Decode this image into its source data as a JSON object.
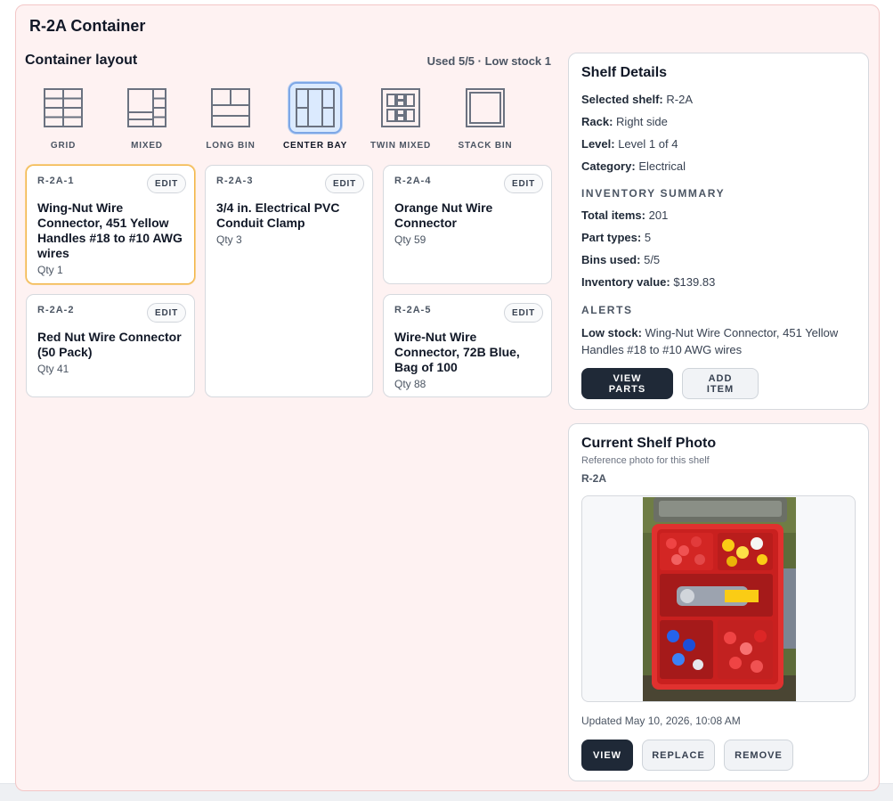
{
  "panel": {
    "title": "R-2A Container"
  },
  "layout": {
    "title": "Container layout",
    "stats": "Used 5/5 · Low stock 1",
    "options": [
      {
        "label": "GRID",
        "icon": "grid-layout-icon",
        "selected": false
      },
      {
        "label": "MIXED",
        "icon": "mixed-layout-icon",
        "selected": false
      },
      {
        "label": "LONG BIN",
        "icon": "long-bin-layout-icon",
        "selected": false
      },
      {
        "label": "CENTER BAY",
        "icon": "center-bay-layout-icon",
        "selected": true
      },
      {
        "label": "TWIN MIXED",
        "icon": "twin-mixed-layout-icon",
        "selected": false
      },
      {
        "label": "STACK BIN",
        "icon": "stack-bin-layout-icon",
        "selected": false
      }
    ]
  },
  "bins": [
    {
      "code": "R-2A-1",
      "name": "Wing-Nut Wire Connector, 451 Yellow Handles #18 to #10 AWG wires",
      "qty": "Qty 1",
      "edit": "EDIT",
      "low_stock": true
    },
    {
      "code": "R-2A-2",
      "name": "Red Nut Wire Connector (50 Pack)",
      "qty": "Qty 41",
      "edit": "EDIT",
      "low_stock": false
    },
    {
      "code": "R-2A-3",
      "name": "3/4 in. Electrical PVC Conduit Clamp",
      "qty": "Qty 3",
      "edit": "EDIT",
      "low_stock": false
    },
    {
      "code": "R-2A-4",
      "name": "Orange Nut Wire Connector",
      "qty": "Qty 59",
      "edit": "EDIT",
      "low_stock": false
    },
    {
      "code": "R-2A-5",
      "name": "Wire-Nut Wire Connector, 72B Blue, Bag of 100",
      "qty": "Qty 88",
      "edit": "EDIT",
      "low_stock": false
    }
  ],
  "shelf_details": {
    "title": "Shelf Details",
    "rows": [
      {
        "label": "Selected shelf:",
        "value": "R-2A"
      },
      {
        "label": "Rack:",
        "value": "Right side"
      },
      {
        "label": "Level:",
        "value": "Level 1 of 4"
      },
      {
        "label": "Category:",
        "value": "Electrical"
      }
    ],
    "summary_heading": "INVENTORY SUMMARY",
    "summary": [
      {
        "label": "Total items:",
        "value": "201"
      },
      {
        "label": "Part types:",
        "value": "5"
      },
      {
        "label": "Bins used:",
        "value": "5/5"
      },
      {
        "label": "Inventory value:",
        "value": "$139.83"
      }
    ],
    "alerts_heading": "ALERTS",
    "alert": {
      "label": "Low stock:",
      "value": "Wing-Nut Wire Connector, 451 Yellow Handles #18 to #10 AWG wires"
    },
    "view_parts": "VIEW PARTS",
    "add_item": "ADD ITEM"
  },
  "shelf_photo": {
    "title": "Current Shelf Photo",
    "subtitle": "Reference photo for this shelf",
    "code": "R-2A",
    "updated": "Updated May 10, 2026, 10:08 AM",
    "view": "VIEW",
    "replace": "REPLACE",
    "remove": "REMOVE"
  },
  "colors": {
    "accent_dark": "#1f2937",
    "low_stock_border": "#f3b548",
    "selected_layout_bg": "#dbeafe",
    "panel_bg": "#fef2f2"
  }
}
